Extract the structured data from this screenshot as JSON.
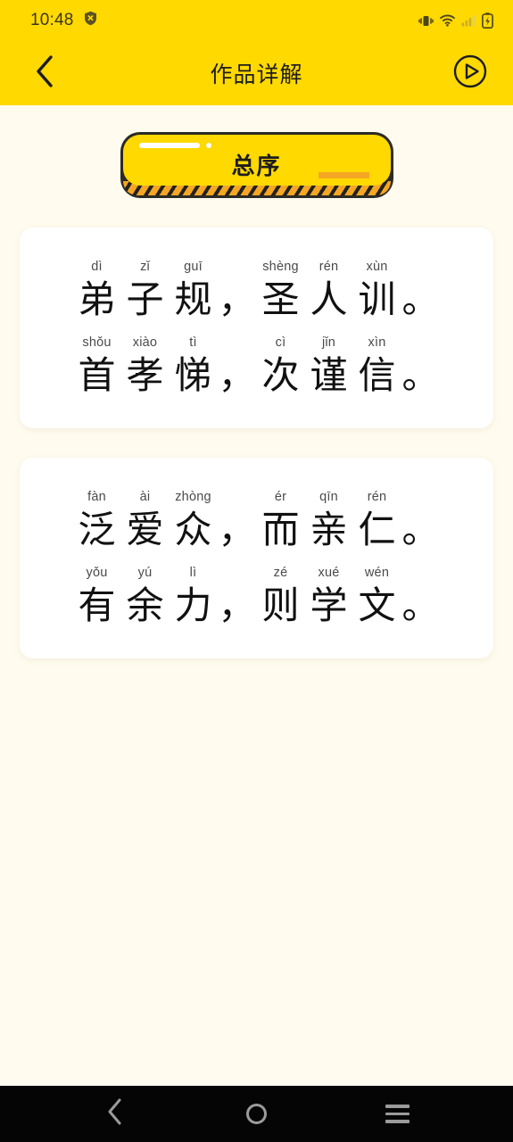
{
  "status_bar": {
    "time": "10:48",
    "icons": [
      "shield-icon",
      "vibrate-icon",
      "wifi-icon",
      "signal-icon",
      "battery-charging-icon"
    ]
  },
  "header": {
    "title": "作品详解",
    "back_icon": "chevron-left-icon",
    "play_icon": "play-circle-icon",
    "background_color": "#FFD900"
  },
  "banner": {
    "label": "总序",
    "face_color": "#FFD900",
    "accent_color": "#F5A623",
    "border_color": "#2B2B26"
  },
  "page": {
    "background_color": "#FFFBEE",
    "card_color": "#FFFFFF"
  },
  "cards": [
    {
      "lines": [
        {
          "slots": [
            {
              "pinyin": "dì",
              "hanzi": "弟",
              "punct": false
            },
            {
              "pinyin": "zǐ",
              "hanzi": "子",
              "punct": false
            },
            {
              "pinyin": "guī",
              "hanzi": "规",
              "punct": false
            },
            {
              "pinyin": "",
              "hanzi": "，",
              "punct": true
            },
            {
              "pinyin": "shèng",
              "hanzi": "圣",
              "punct": false
            },
            {
              "pinyin": "rén",
              "hanzi": "人",
              "punct": false
            },
            {
              "pinyin": "xùn",
              "hanzi": "训",
              "punct": false
            },
            {
              "pinyin": "",
              "hanzi": "。",
              "punct": true
            }
          ]
        },
        {
          "slots": [
            {
              "pinyin": "shǒu",
              "hanzi": "首",
              "punct": false
            },
            {
              "pinyin": "xiào",
              "hanzi": "孝",
              "punct": false
            },
            {
              "pinyin": "tì",
              "hanzi": "悌",
              "punct": false
            },
            {
              "pinyin": "",
              "hanzi": "，",
              "punct": true
            },
            {
              "pinyin": "cì",
              "hanzi": "次",
              "punct": false
            },
            {
              "pinyin": "jǐn",
              "hanzi": "谨",
              "punct": false
            },
            {
              "pinyin": "xìn",
              "hanzi": "信",
              "punct": false
            },
            {
              "pinyin": "",
              "hanzi": "。",
              "punct": true
            }
          ]
        }
      ]
    },
    {
      "lines": [
        {
          "slots": [
            {
              "pinyin": "fàn",
              "hanzi": "泛",
              "punct": false
            },
            {
              "pinyin": "ài",
              "hanzi": "爱",
              "punct": false
            },
            {
              "pinyin": "zhòng",
              "hanzi": "众",
              "punct": false
            },
            {
              "pinyin": "",
              "hanzi": "，",
              "punct": true
            },
            {
              "pinyin": "ér",
              "hanzi": "而",
              "punct": false
            },
            {
              "pinyin": "qīn",
              "hanzi": "亲",
              "punct": false
            },
            {
              "pinyin": "rén",
              "hanzi": "仁",
              "punct": false
            },
            {
              "pinyin": "",
              "hanzi": "。",
              "punct": true
            }
          ]
        },
        {
          "slots": [
            {
              "pinyin": "yǒu",
              "hanzi": "有",
              "punct": false
            },
            {
              "pinyin": "yú",
              "hanzi": "余",
              "punct": false
            },
            {
              "pinyin": "lì",
              "hanzi": "力",
              "punct": false
            },
            {
              "pinyin": "",
              "hanzi": "，",
              "punct": true
            },
            {
              "pinyin": "zé",
              "hanzi": "则",
              "punct": false
            },
            {
              "pinyin": "xué",
              "hanzi": "学",
              "punct": false
            },
            {
              "pinyin": "wén",
              "hanzi": "文",
              "punct": false
            },
            {
              "pinyin": "",
              "hanzi": "。",
              "punct": true
            }
          ]
        }
      ]
    }
  ],
  "nav_bar": {
    "back_icon": "chevron-left-icon",
    "home_icon": "circle-home-icon",
    "recents_icon": "hamburger-recents-icon"
  }
}
